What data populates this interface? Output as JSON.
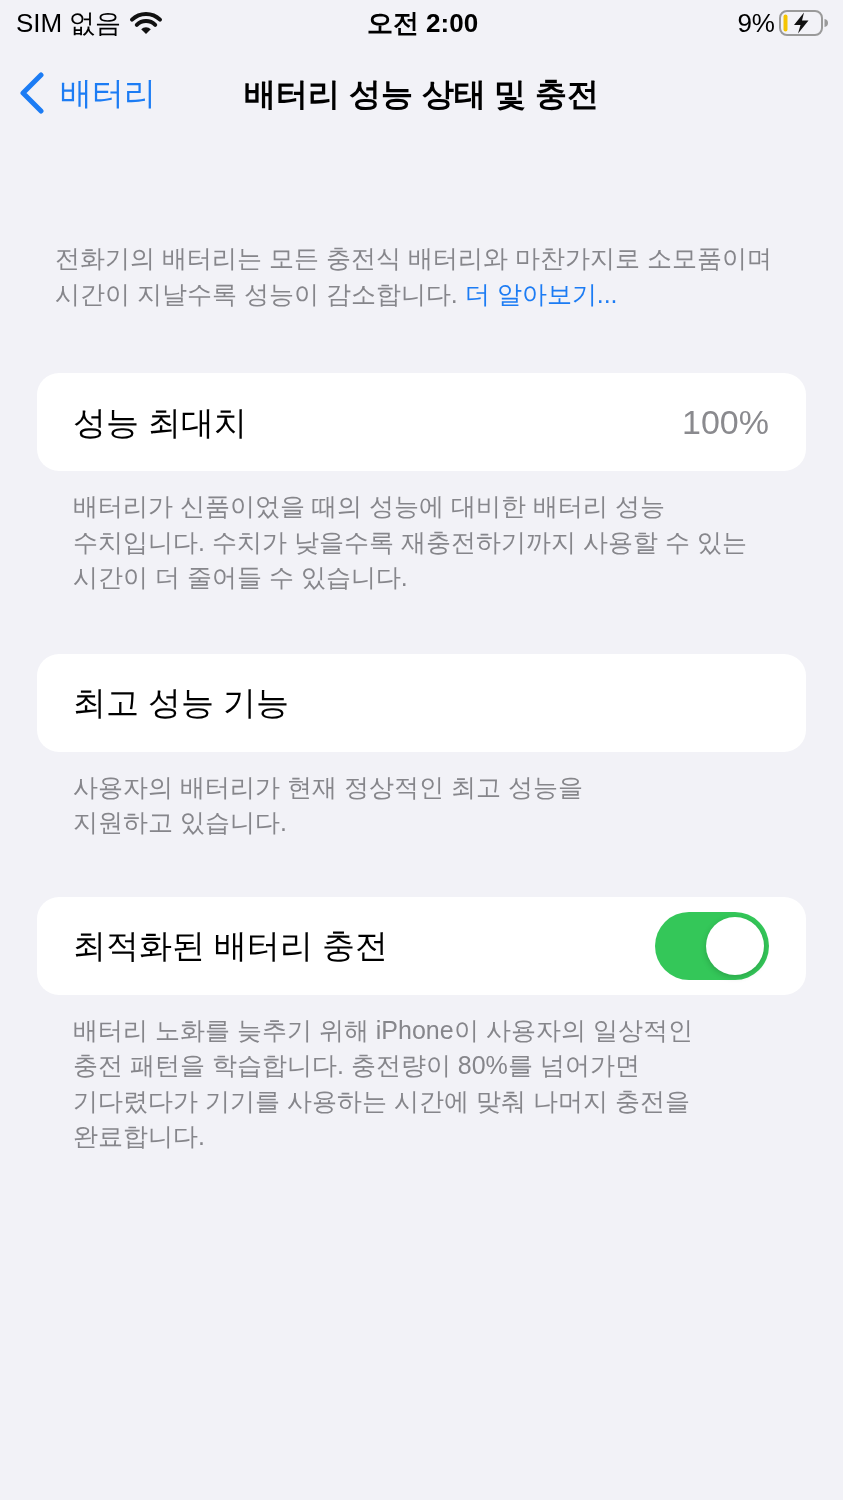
{
  "status_bar": {
    "carrier": "SIM 없음",
    "time": "오전 2:00",
    "battery_percent": "9%"
  },
  "nav": {
    "back": "배터리",
    "title": "배터리 성능 상태 및 충전"
  },
  "intro": {
    "text": "전화기의 배터리는 모든 충전식 배터리와 마찬가지로 소모품이며\n시간이 지날수록 성능이 감소합니다.",
    "link": "더 알아보기..."
  },
  "sections": [
    {
      "kind": "value",
      "label": "성능 최대치",
      "value": "100%",
      "footer": "배터리가 신품이었을 때의 성능에 대비한 배터리 성능\n수치입니다. 수치가 낮을수록 재충전하기까지 사용할 수 있는\n시간이 더 줄어들 수 있습니다."
    },
    {
      "kind": "plain",
      "label": "최고 성능 기능",
      "footer": "사용자의 배터리가 현재 정상적인 최고 성능을\n지원하고 있습니다."
    },
    {
      "kind": "toggle",
      "label": "최적화된 배터리 충전",
      "on": true,
      "footer": "배터리 노화를 늦추기 위해 iPhone이 사용자의 일상적인\n충전 패턴을 학습합니다. 충전량이 80%를 넘어가면\n기다렸다가 기기를 사용하는 시간에 맞춰 나머지 충전을\n완료합니다."
    }
  ]
}
